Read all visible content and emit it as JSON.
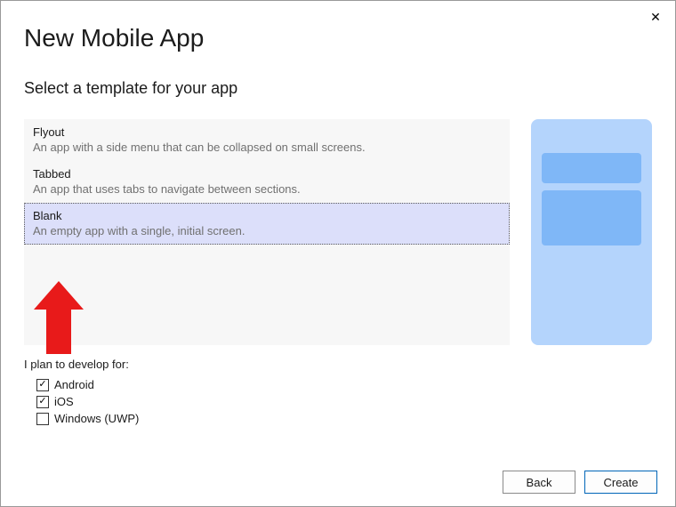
{
  "title": "New Mobile App",
  "subtitle": "Select a template for your app",
  "templates": [
    {
      "name": "Flyout",
      "desc": "An app with a side menu that can be collapsed on small screens."
    },
    {
      "name": "Tabbed",
      "desc": "An app that uses tabs to navigate between sections."
    },
    {
      "name": "Blank",
      "desc": "An empty app with a single, initial screen."
    }
  ],
  "selected_template_index": 2,
  "develop_for": {
    "label": "I plan to develop for:",
    "options": [
      {
        "label": "Android",
        "checked": true
      },
      {
        "label": "iOS",
        "checked": true
      },
      {
        "label": "Windows (UWP)",
        "checked": false
      }
    ]
  },
  "buttons": {
    "back": "Back",
    "create": "Create"
  },
  "checkmark": "✓"
}
